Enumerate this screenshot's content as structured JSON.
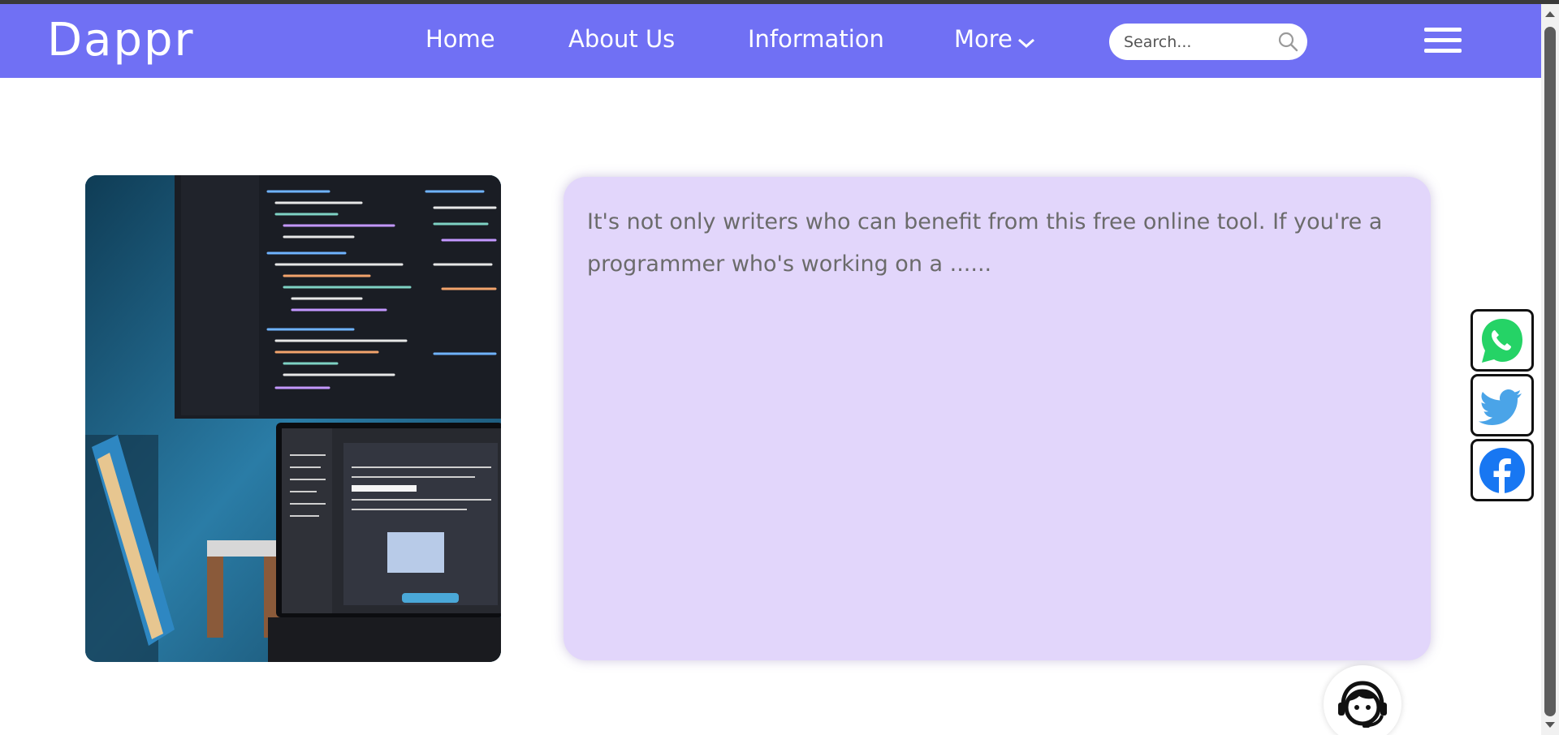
{
  "brand": {
    "logo_text": "Dappr"
  },
  "nav": {
    "items": [
      {
        "label": "Home"
      },
      {
        "label": "About Us"
      },
      {
        "label": "Information"
      },
      {
        "label": "More"
      }
    ]
  },
  "search": {
    "placeholder": "Search..."
  },
  "content": {
    "excerpt": "It's not only writers who can benefit from this free online tool. If you're a programmer who's working on a ......"
  },
  "social": {
    "buttons": [
      {
        "icon": "whatsapp-icon",
        "color": "#25d366"
      },
      {
        "icon": "twitter-icon",
        "color": "#4aa4e8"
      },
      {
        "icon": "facebook-icon",
        "color": "#1877f2"
      }
    ]
  },
  "colors": {
    "navbar": "#7070f4",
    "card_background": "#e2d6fb",
    "text": "#6b6b6b"
  },
  "icons": [
    "chevron-down-icon",
    "search-icon",
    "hamburger-menu-icon",
    "support-agent-icon"
  ]
}
